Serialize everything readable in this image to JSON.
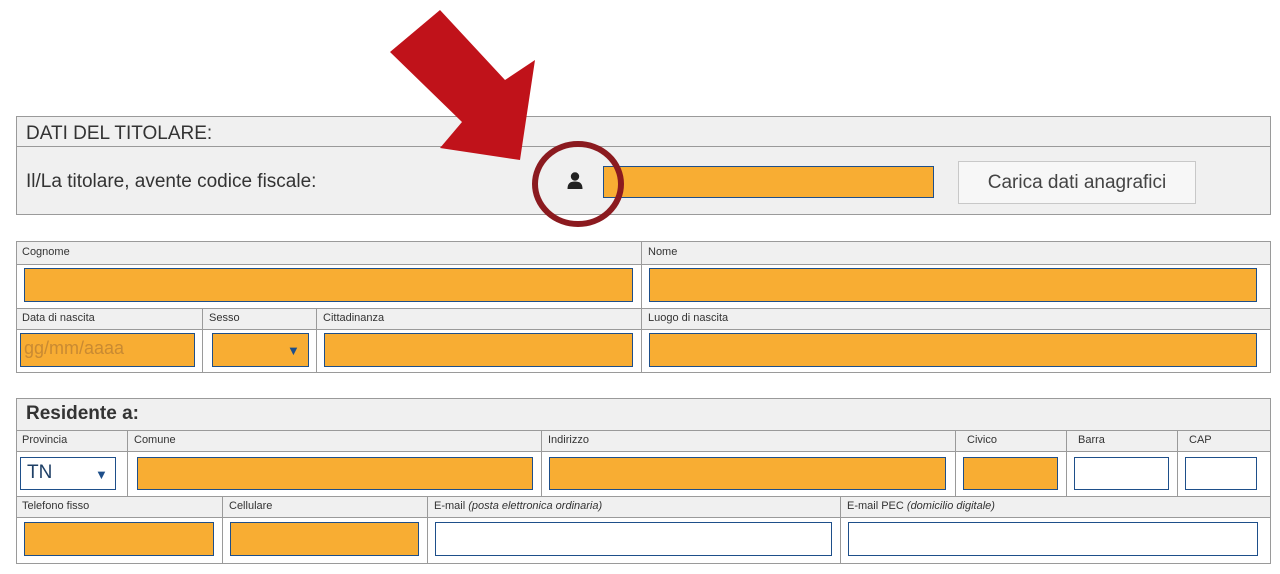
{
  "titolare": {
    "title": "DATI DEL TITOLARE:",
    "label": "Il/La titolare, avente codice fiscale:",
    "codice_fiscale_value": "",
    "button_label": "Carica dati anagrafici"
  },
  "anagrafica": {
    "cognome_label": "Cognome",
    "nome_label": "Nome",
    "data_nascita_label": "Data di nascita",
    "data_nascita_placeholder": "gg/mm/aaaa",
    "sesso_label": "Sesso",
    "cittadinanza_label": "Cittadinanza",
    "luogo_nascita_label": "Luogo di nascita"
  },
  "residenza": {
    "title": "Residente a:",
    "provincia_label": "Provincia",
    "provincia_value": "TN",
    "comune_label": "Comune",
    "indirizzo_label": "Indirizzo",
    "civico_label": "Civico",
    "barra_label": "Barra",
    "cap_label": "CAP",
    "telefono_label": "Telefono fisso",
    "cellulare_label": "Cellulare",
    "email_label": "E-mail",
    "email_note": "(posta elettronica ordinaria)",
    "pec_label": "E-mail PEC",
    "pec_note": "(domicilio digitale)"
  },
  "colors": {
    "field_fill": "#f8ad33",
    "field_border": "#1e4f8a",
    "arrow": "#c0121a",
    "circle": "#8b1a1f"
  },
  "icons": {
    "user": "user-icon",
    "arrow": "red-arrow-annotation",
    "circle": "circle-highlight-annotation",
    "dropdown": "chevron-down-icon"
  }
}
